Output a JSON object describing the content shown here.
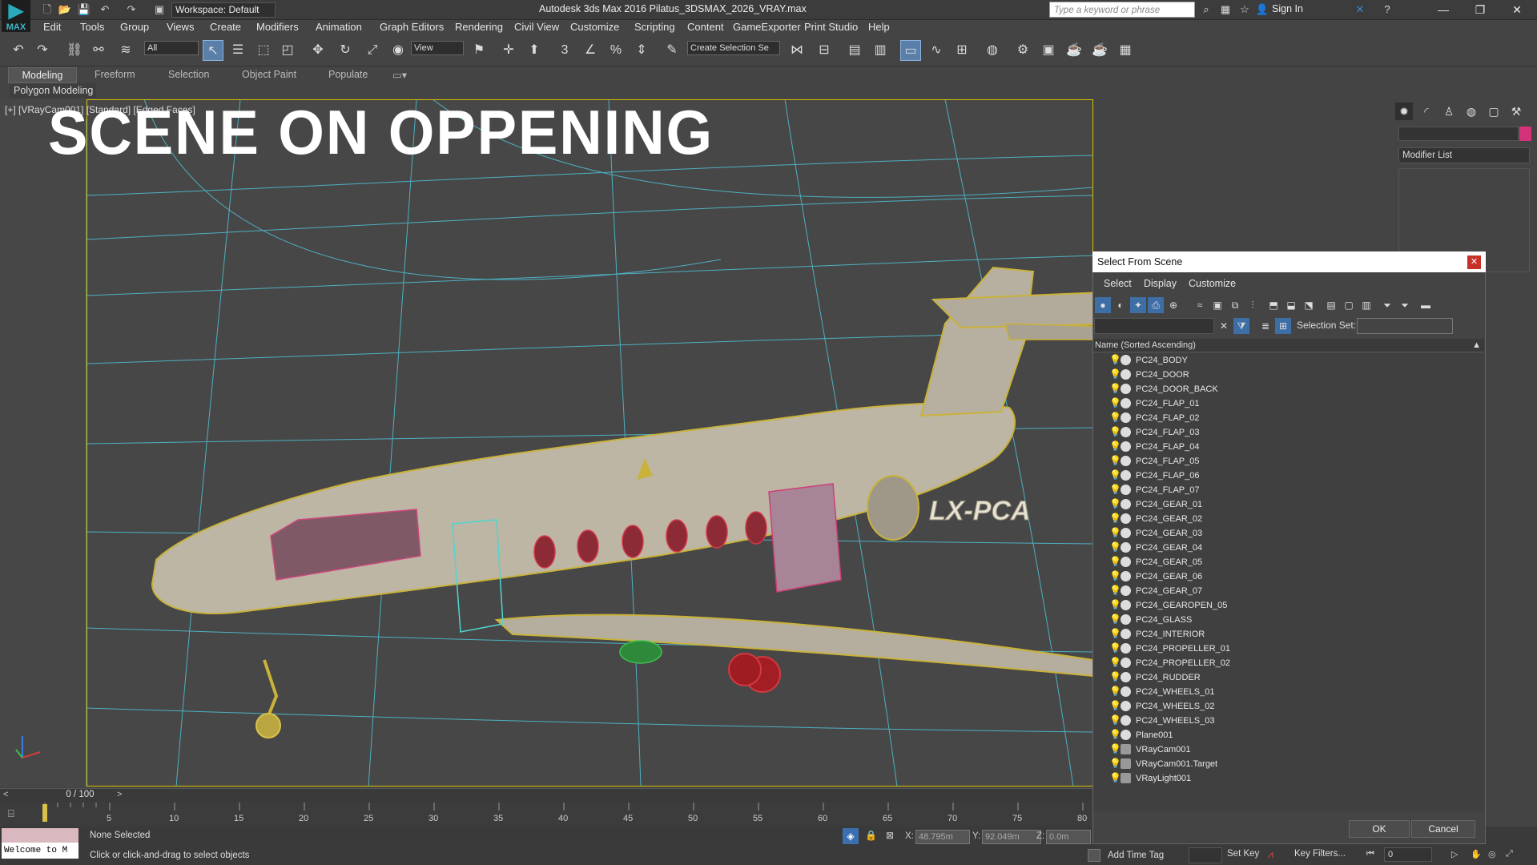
{
  "window": {
    "title": "Autodesk 3ds Max 2016     Pilatus_3DSMAX_2026_VRAY.max",
    "workspace": "Workspace: Default",
    "search_placeholder": "Type a keyword or phrase",
    "sign_in": "Sign In",
    "logo_text": "MAX"
  },
  "menu": [
    "Edit",
    "Tools",
    "Group",
    "Views",
    "Create",
    "Modifiers",
    "Animation",
    "Graph Editors",
    "Rendering",
    "Civil View",
    "Customize",
    "Scripting",
    "Content",
    "GameExporter",
    "Print Studio",
    "Help"
  ],
  "toolbar": {
    "filter_value": "All",
    "coord_value": "View",
    "selection_set_value": "Create Selection Se"
  },
  "ribbon": {
    "tabs": [
      "Modeling",
      "Freeform",
      "Selection",
      "Object Paint",
      "Populate"
    ],
    "panel_label": "Polygon Modeling"
  },
  "viewport": {
    "label": "[+] [VRayCam001] [Standard] [Edged Faces]",
    "overlay_text": "SCENE ON OPPENING",
    "tail_registration": "LX-PCA"
  },
  "timeline": {
    "counter": "0 / 100",
    "ticks": [
      "5",
      "10",
      "15",
      "20",
      "25",
      "30",
      "35",
      "40",
      "45",
      "50",
      "55",
      "60",
      "65",
      "70",
      "75",
      "80"
    ]
  },
  "status": {
    "welcome": "Welcome to M",
    "selection": "None Selected",
    "hint": "Click or click-and-drag to select objects",
    "x_label": "X:",
    "x_value": "48.795m",
    "y_label": "Y:",
    "y_value": "92.049m",
    "z_label": "Z:",
    "z_value": "0.0m",
    "add_time_tag": "Add Time Tag",
    "set_key": "Set Key",
    "key_filters": "Key Filters...",
    "frame": "0"
  },
  "command_panel": {
    "modifier_list": "Modifier List",
    "accent_color": "#d4327b"
  },
  "dialog": {
    "title": "Select From Scene",
    "menus": [
      "Select",
      "Display",
      "Customize"
    ],
    "selection_set_label": "Selection Set:",
    "column_header": "Name (Sorted Ascending)",
    "ok": "OK",
    "cancel": "Cancel",
    "objects": [
      {
        "name": "PC24_BODY",
        "type": "geometry"
      },
      {
        "name": "PC24_DOOR",
        "type": "geometry"
      },
      {
        "name": "PC24_DOOR_BACK",
        "type": "geometry"
      },
      {
        "name": "PC24_FLAP_01",
        "type": "geometry"
      },
      {
        "name": "PC24_FLAP_02",
        "type": "geometry"
      },
      {
        "name": "PC24_FLAP_03",
        "type": "geometry"
      },
      {
        "name": "PC24_FLAP_04",
        "type": "geometry"
      },
      {
        "name": "PC24_FLAP_05",
        "type": "geometry"
      },
      {
        "name": "PC24_FLAP_06",
        "type": "geometry"
      },
      {
        "name": "PC24_FLAP_07",
        "type": "geometry"
      },
      {
        "name": "PC24_GEAR_01",
        "type": "geometry"
      },
      {
        "name": "PC24_GEAR_02",
        "type": "geometry"
      },
      {
        "name": "PC24_GEAR_03",
        "type": "geometry"
      },
      {
        "name": "PC24_GEAR_04",
        "type": "geometry"
      },
      {
        "name": "PC24_GEAR_05",
        "type": "geometry"
      },
      {
        "name": "PC24_GEAR_06",
        "type": "geometry"
      },
      {
        "name": "PC24_GEAR_07",
        "type": "geometry"
      },
      {
        "name": "PC24_GEAROPEN_05",
        "type": "geometry"
      },
      {
        "name": "PC24_GLASS",
        "type": "geometry"
      },
      {
        "name": "PC24_INTERIOR",
        "type": "geometry"
      },
      {
        "name": "PC24_PROPELLER_01",
        "type": "geometry"
      },
      {
        "name": "PC24_PROPELLER_02",
        "type": "geometry"
      },
      {
        "name": "PC24_RUDDER",
        "type": "geometry"
      },
      {
        "name": "PC24_WHEELS_01",
        "type": "geometry"
      },
      {
        "name": "PC24_WHEELS_02",
        "type": "geometry"
      },
      {
        "name": "PC24_WHEELS_03",
        "type": "geometry"
      },
      {
        "name": "Plane001",
        "type": "geometry"
      },
      {
        "name": "VRayCam001",
        "type": "camera"
      },
      {
        "name": "VRayCam001.Target",
        "type": "camera"
      },
      {
        "name": "VRayLight001",
        "type": "light"
      }
    ]
  }
}
